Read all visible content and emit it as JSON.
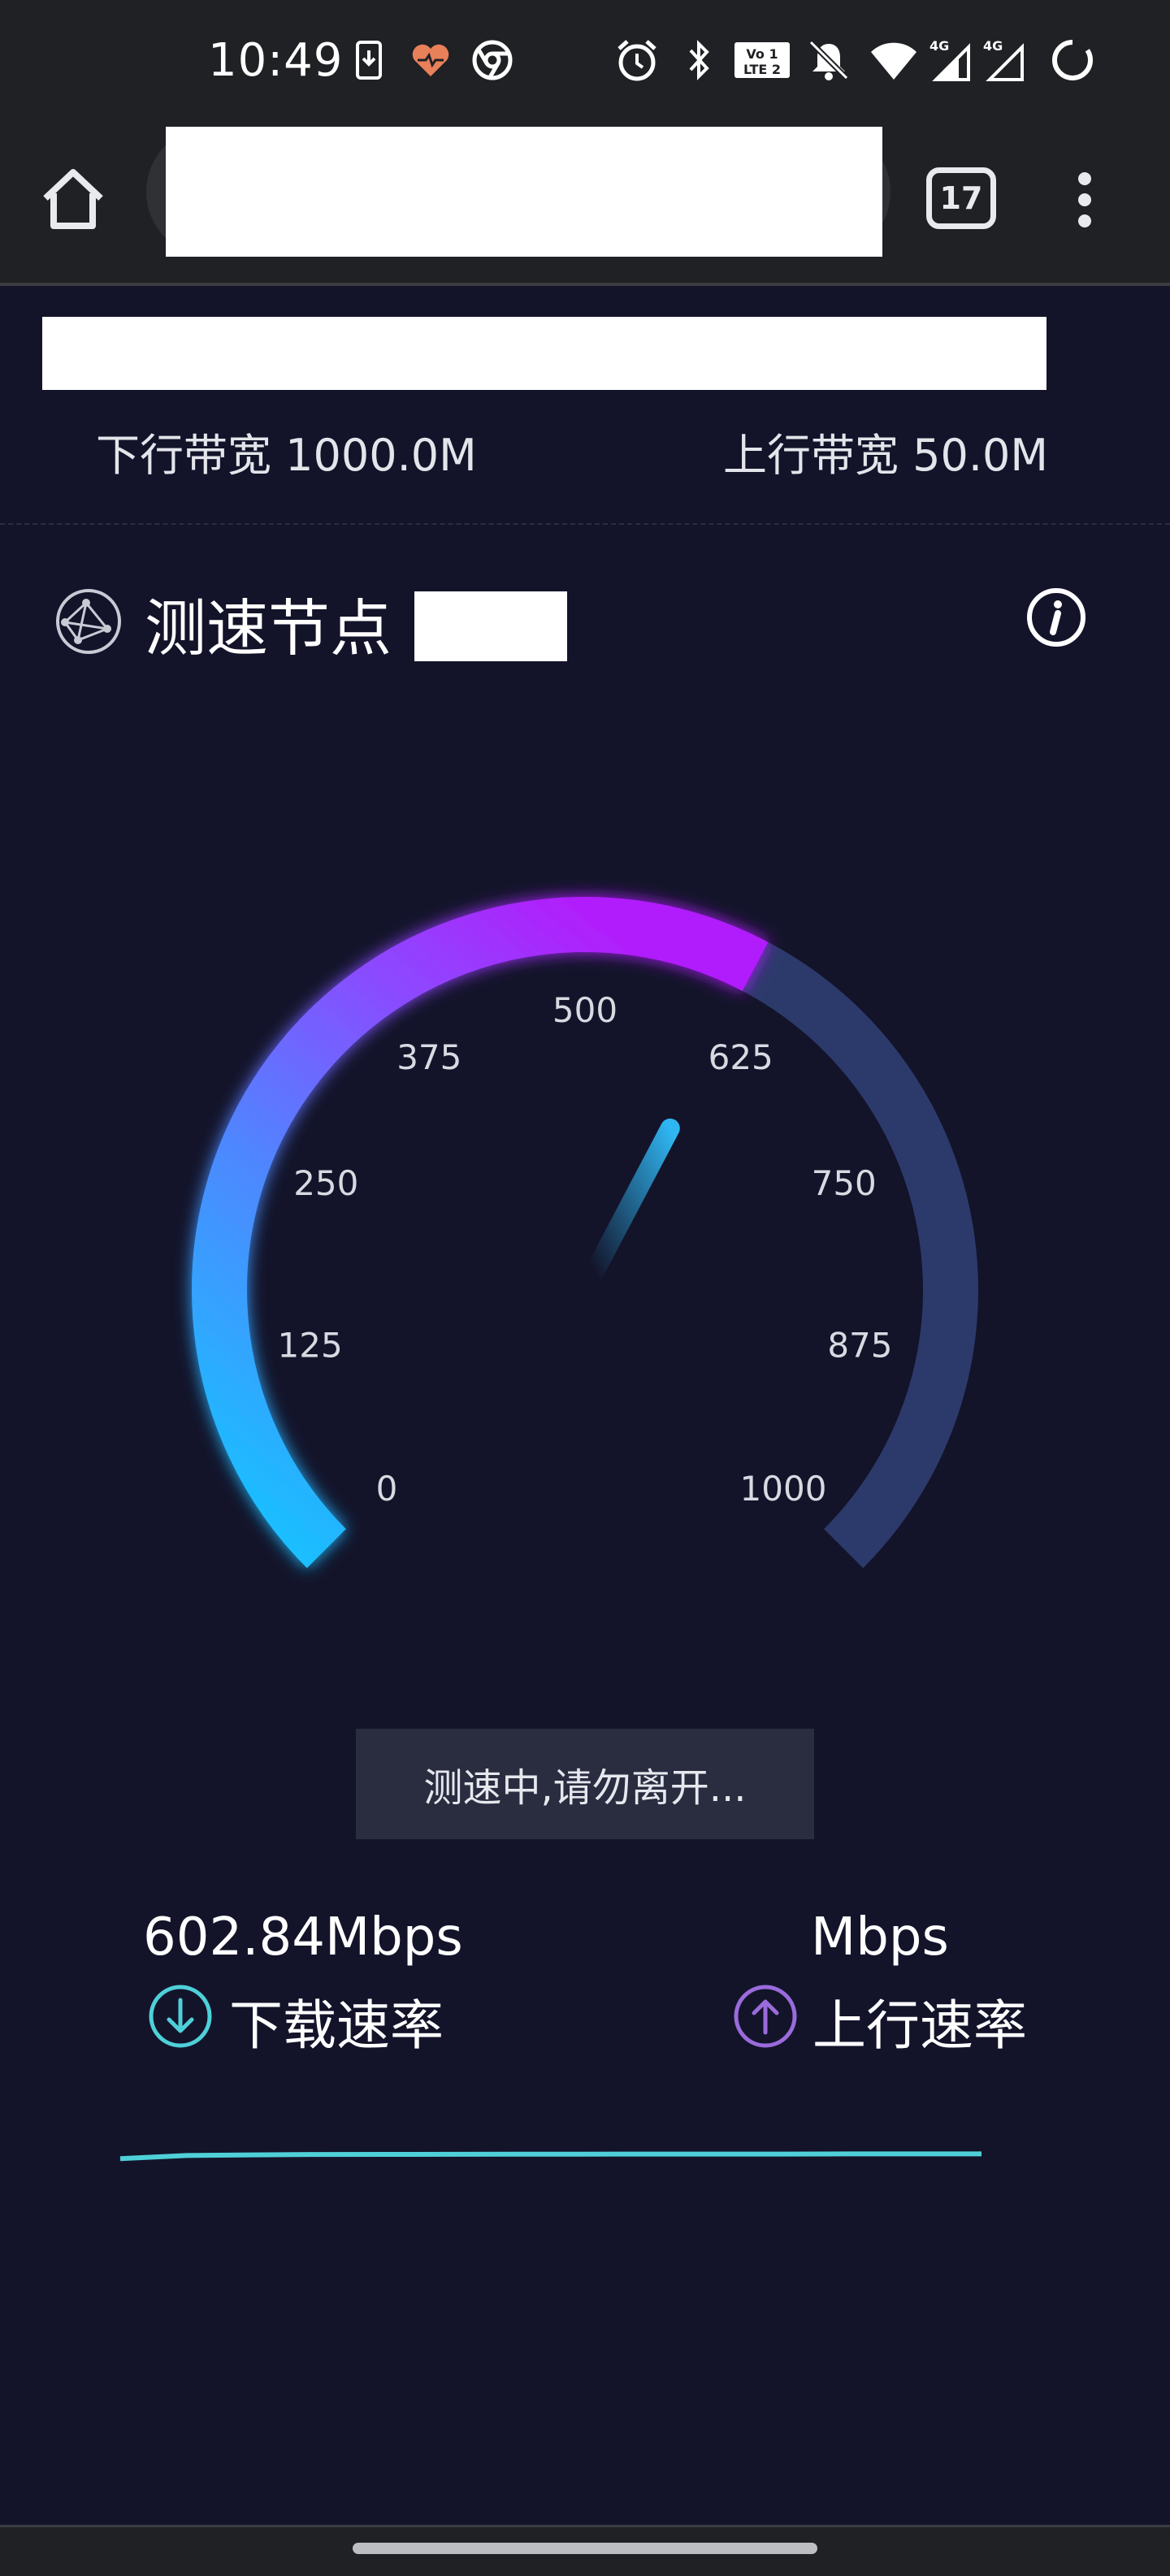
{
  "status_bar": {
    "time": "10:49",
    "icons": [
      "download-notification-icon",
      "heart-app-icon",
      "chrome-icon",
      "alarm-icon",
      "bluetooth-icon",
      "volte-icon",
      "mute-icon",
      "wifi-icon",
      "signal-4g-icon",
      "signal-4g-icon",
      "loading-circle-icon"
    ]
  },
  "browser": {
    "tab_count": "17"
  },
  "bandwidth": {
    "down_label": "下行带宽 1000.0M",
    "up_label": "上行带宽 50.0M"
  },
  "node": {
    "label": "测速节点"
  },
  "gauge": {
    "ticks": [
      "0",
      "125",
      "250",
      "375",
      "500",
      "625",
      "750",
      "875",
      "1000"
    ],
    "max": 1000,
    "current_value": 602.84,
    "colors": {
      "low": "#12c8ff",
      "mid": "#6a6bff",
      "high": "#b01ffb",
      "track": "#2c3a6b",
      "needle": "#2fb6f2"
    }
  },
  "status_message": "测速中,请勿离开...",
  "results": {
    "download_value": "602.84Mbps",
    "download_label": "下载速率",
    "upload_value": "Mbps",
    "upload_label": "上行速率",
    "download_color": "#4fd0d8",
    "upload_color": "#9a6bdc"
  },
  "speed_trace": {
    "color": "#4fd0d8",
    "y_max": 1000,
    "values": [
      562,
      590,
      596,
      599,
      600,
      601,
      602,
      602,
      603,
      603,
      603,
      604,
      604,
      604
    ]
  }
}
